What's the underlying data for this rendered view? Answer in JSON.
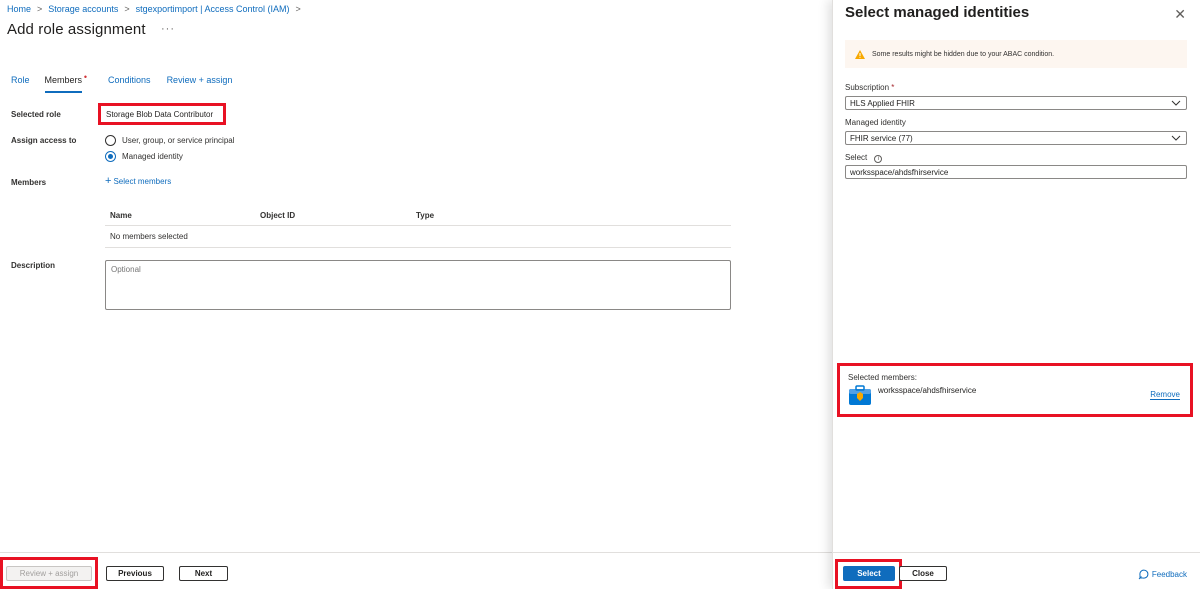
{
  "breadcrumb": {
    "items": [
      "Home",
      "Storage accounts",
      "stgexportimport | Access Control (IAM)"
    ],
    "separator": ">"
  },
  "page": {
    "title": "Add role assignment",
    "more": "···"
  },
  "tabs": [
    {
      "label": "Role"
    },
    {
      "label": "Members",
      "required_mark": "•"
    },
    {
      "label": "Conditions"
    },
    {
      "label": "Review + assign"
    }
  ],
  "form": {
    "selected_role_label": "Selected role",
    "selected_role_value": "Storage Blob Data Contributor",
    "assign_access_label": "Assign access to",
    "assign_options": [
      "User, group, or service principal",
      "Managed identity"
    ],
    "assign_selected_index": 1,
    "members_label": "Members",
    "select_members_link": "Select members",
    "select_members_plus": "+",
    "table_headers": {
      "name": "Name",
      "object_id": "Object ID",
      "type": "Type"
    },
    "table_empty": "No members selected",
    "description_label": "Description",
    "description_placeholder": "Optional"
  },
  "footer": {
    "review_assign": "Review + assign",
    "previous": "Previous",
    "next": "Next"
  },
  "panel": {
    "title": "Select managed identities",
    "close_glyph": "✕",
    "warning": "Some results might be hidden due to your ABAC condition.",
    "subscription_label": "Subscription",
    "required_mark": "*",
    "subscription_value": "HLS Applied FHIR",
    "managed_identity_label": "Managed identity",
    "managed_identity_value": "FHIR service (77)",
    "select_label": "Select",
    "info_glyph": "i",
    "select_value": "worksspace/ahdsfhirservice",
    "selected_members_label": "Selected members:",
    "selected_member_name": "worksspace/ahdsfhirservice",
    "remove": "Remove",
    "select_button": "Select",
    "close_button": "Close",
    "feedback": "Feedback"
  },
  "colors": {
    "accent": "#0f6cbd",
    "highlight": "#e81123",
    "warning_icon": "#f7a800"
  }
}
